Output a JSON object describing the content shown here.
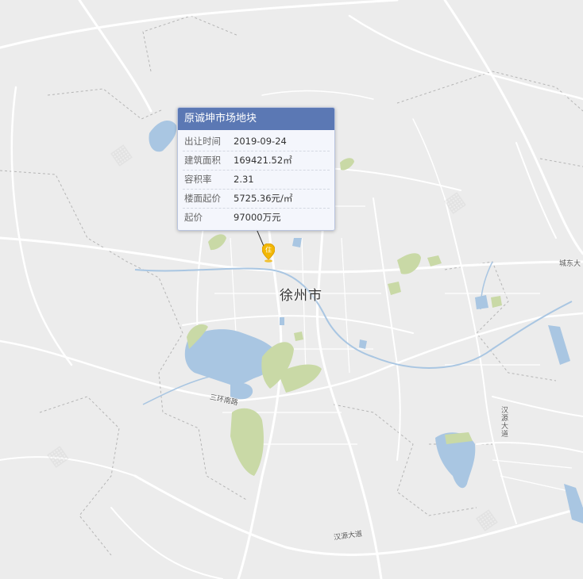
{
  "map": {
    "city_label": "徐州市",
    "road_labels": {
      "third_ring_south": "三环南路",
      "chengdong": "城东大",
      "hanyuan_vertical": "汉源大道",
      "hanyuan_bottom": "汉源大道"
    }
  },
  "popup": {
    "title": "原诚坤市场地块",
    "rows": [
      {
        "label": "出让时间",
        "value": "2019-09-24"
      },
      {
        "label": "建筑面积",
        "value": "169421.52㎡"
      },
      {
        "label": "容积率",
        "value": "2.31"
      },
      {
        "label": "楼面起价",
        "value": "5725.36元/㎡"
      },
      {
        "label": "起价",
        "value": "97000万元"
      }
    ]
  },
  "marker": {
    "glyph": "住",
    "icon": "residential-pin-icon",
    "color": "#f2b705"
  },
  "colors": {
    "background": "#ececec",
    "road": "#ffffff",
    "water": "#a9c6e2",
    "green": "#c9d9a6",
    "header": "#5b78b4"
  }
}
